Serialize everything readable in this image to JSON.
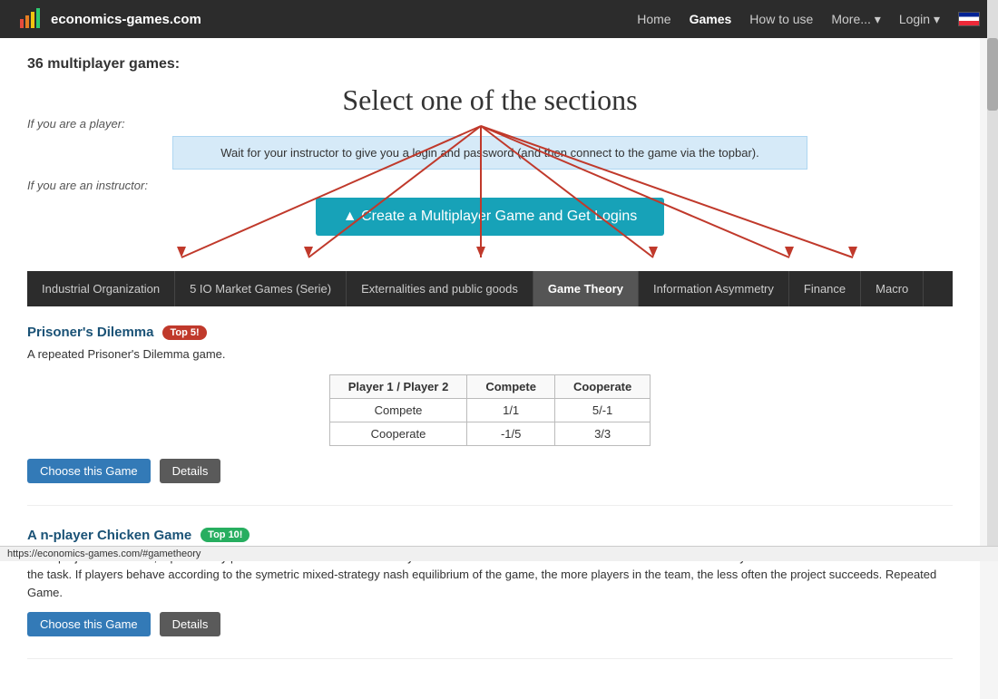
{
  "navbar": {
    "brand": "economics-games.com",
    "links": [
      {
        "label": "Home",
        "active": false
      },
      {
        "label": "Games",
        "active": true
      },
      {
        "label": "How to use",
        "active": false
      },
      {
        "label": "More...",
        "active": false,
        "dropdown": true
      },
      {
        "label": "Login",
        "active": false,
        "dropdown": true
      }
    ]
  },
  "main": {
    "page_count": "36 multiplayer games:",
    "select_section_title": "Select one of the sections",
    "if_player_label": "If you are a player:",
    "if_instructor_label": "If you are an instructor:",
    "player_message": "Wait for your instructor to give you a login and password (and then connect to the game via the topbar).",
    "create_game_btn": "Create a Multiplayer Game and Get Logins",
    "tabs": [
      {
        "label": "Industrial Organization",
        "active": false
      },
      {
        "label": "5 IO Market Games (Serie)",
        "active": false
      },
      {
        "label": "Externalities and public goods",
        "active": false
      },
      {
        "label": "Game Theory",
        "active": true
      },
      {
        "label": "Information Asymmetry",
        "active": false
      },
      {
        "label": "Finance",
        "active": false
      },
      {
        "label": "Macro",
        "active": false
      }
    ],
    "games": [
      {
        "title": "Prisoner's Dilemma",
        "badge": "Top 5!",
        "badge_type": "red",
        "description": "A repeated Prisoner's Dilemma game.",
        "has_table": true,
        "table": {
          "col_header_1": "Player 1 / Player 2",
          "col_header_2": "Compete",
          "col_header_3": "Cooperate",
          "row1_label": "Compete",
          "row1_col2": "1/1",
          "row1_col3": "5/-1",
          "row2_label": "Cooperate",
          "row2_col2": "-1/5",
          "row2_col3": "3/3"
        },
        "btn_choose": "Choose this Game",
        "btn_details": "Details"
      },
      {
        "title": "A n-player Chicken Game",
        "badge": "Top 10!",
        "badge_type": "green",
        "description": "For a project to succeed, a particularly painful task must be undertaken by at least one member of a team. Team members simultaneously choose whether or not to undertake the task. If players behave according to the symetric mixed-strategy nash equilibrium of the game, the more players in the team, the less often the project succeeds. Repeated Game.",
        "has_table": false,
        "btn_choose": "Choose this Game",
        "btn_details": "Details"
      }
    ]
  },
  "status_bar": {
    "url": "https://economics-games.com/#gametheory"
  }
}
